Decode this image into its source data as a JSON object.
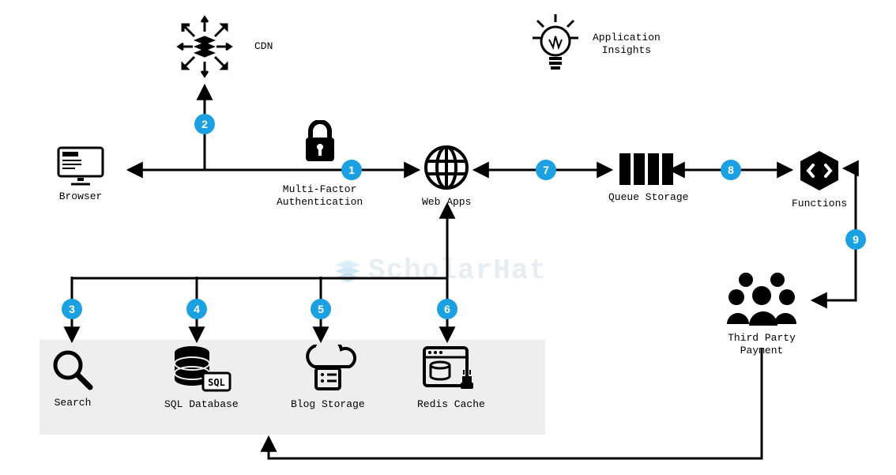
{
  "nodes": {
    "browser": "Browser",
    "cdn": "CDN",
    "mfa": "Multi-Factor\nAuthentication",
    "webapps": "Web Apps",
    "insights": "Application\nInsights",
    "queue": "Queue Storage",
    "functions": "Functions",
    "tpp": "Third Party\nPayment",
    "search": "Search",
    "sqldb": "SQL Database",
    "blog": "Blog Storage",
    "redis": "Redis Cache"
  },
  "badges": {
    "1": "1",
    "2": "2",
    "3": "3",
    "4": "4",
    "5": "5",
    "6": "6",
    "7": "7",
    "8": "8",
    "9": "9"
  },
  "watermark": "ScholarHat",
  "colors": {
    "badge": "#1ba1e2"
  }
}
